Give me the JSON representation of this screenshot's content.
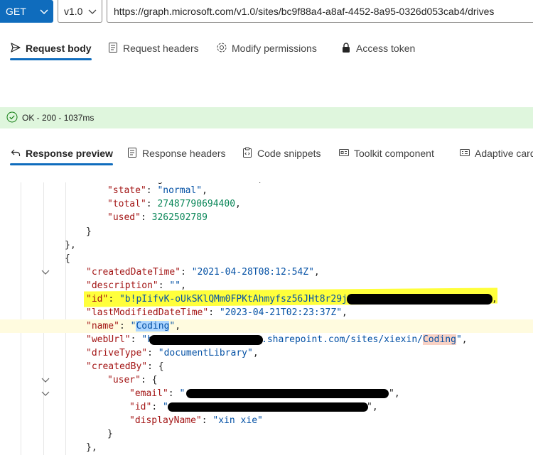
{
  "request": {
    "method": "GET",
    "version": "v1.0",
    "url": "https://graph.microsoft.com/v1.0/sites/bc9f88a4-a8af-4452-8a95-0326d053cab4/drives"
  },
  "request_tabs": [
    {
      "label": "Request body",
      "icon": "send-icon"
    },
    {
      "label": "Request headers",
      "icon": "document-icon"
    },
    {
      "label": "Modify permissions",
      "icon": "gear-icon"
    },
    {
      "label": "Access token",
      "icon": "lock-icon"
    }
  ],
  "status": {
    "text": "OK - 200 - 1037ms",
    "color": "#dff6dd"
  },
  "response_tabs": [
    {
      "label": "Response preview",
      "icon": "arrow-back-icon"
    },
    {
      "label": "Response headers",
      "icon": "document-icon"
    },
    {
      "label": "Code snippets",
      "icon": "clipboard-code-icon"
    },
    {
      "label": "Toolkit component",
      "icon": "toolkit-icon"
    },
    {
      "label": "Adaptive card",
      "icon": "card-icon"
    }
  ],
  "code": {
    "state_key": "\"state\"",
    "state_val": "\"normal\"",
    "total_key": "\"total\"",
    "total_val": "27487790694400",
    "used_key": "\"used\"",
    "used_val": "3262502789",
    "created_key": "\"createdDateTime\"",
    "created_val": "\"2021-04-28T08:12:54Z\"",
    "desc_key": "\"description\"",
    "desc_val": "\"\"",
    "id_key": "\"id\"",
    "id_val": "\"b!pIifvK-oUkSKlQMm0FPKtAhmyfsz56JHt8r29ja",
    "lastmod_key": "\"lastModifiedDateTime\"",
    "lastmod_val": "\"2023-04-21T02:23:37Z\"",
    "name_key": "\"name\"",
    "name_q1": "\"",
    "name_val": "Coding",
    "name_q2": "\"",
    "weburl_key": "\"webUrl\"",
    "weburl_pre": "\"h",
    "weburl_mid": ".sharepoint.com/sites/xiexin/",
    "weburl_hl": "Coding",
    "weburl_end": "\"",
    "drivetype_key": "\"driveType\"",
    "drivetype_val": "\"documentLibrary\"",
    "createdby_key": "\"createdBy\"",
    "user_key": "\"user\"",
    "email_key": "\"email\"",
    "email_val": "\"",
    "uid_key": "\"id\"",
    "uid_val": "\"",
    "displayname_key": "\"displayName\"",
    "displayname_val": "\"xin xie\""
  }
}
